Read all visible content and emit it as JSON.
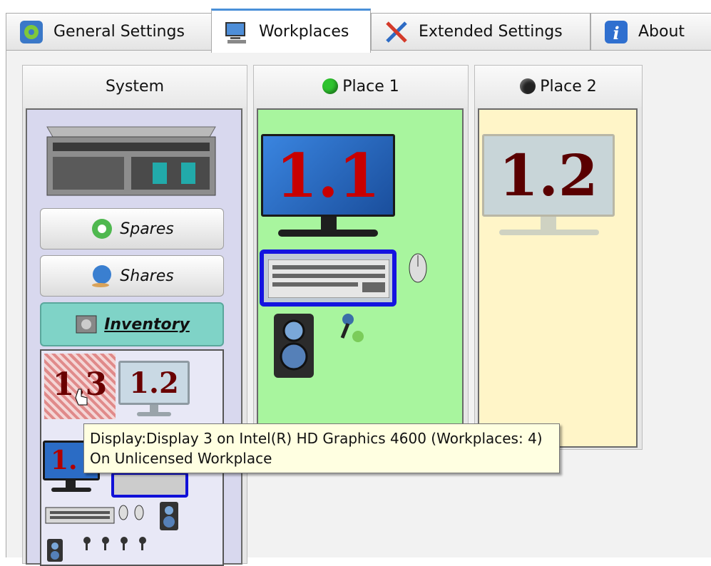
{
  "tabs": [
    {
      "label": "General Settings",
      "icon": "settings-gear-icon"
    },
    {
      "label": "Workplaces",
      "icon": "workplaces-computer-icon"
    },
    {
      "label": "Extended Settings",
      "icon": "tools-icon"
    },
    {
      "label": "About",
      "icon": "info-icon"
    }
  ],
  "active_tab": "Workplaces",
  "system": {
    "title": "System",
    "spares_label": "Spares",
    "shares_label": "Shares",
    "inventory_label": "Inventory",
    "monitor_13": "1.3",
    "monitor_12": "1.2",
    "monitor_partial": "1."
  },
  "place1": {
    "title": "Place 1",
    "status_color": "#2ec32e",
    "monitor": "1.1",
    "bg": "#a8f59e"
  },
  "place2": {
    "title": "Place 2",
    "status_color": "#222222",
    "monitor": "1.2",
    "bg": "#fff5c8"
  },
  "tooltip": {
    "line1": "Display:Display 3 on Intel(R) HD Graphics 4600 (Workplaces: 4)",
    "line2": "On Unlicensed Workplace"
  }
}
